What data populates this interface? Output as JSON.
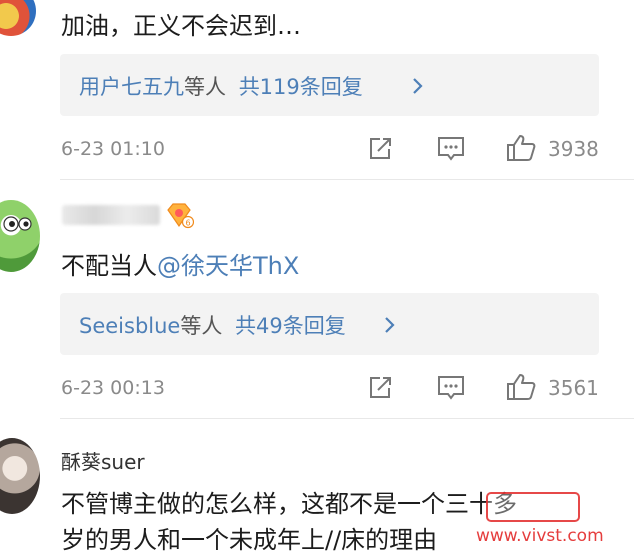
{
  "comments": [
    {
      "text": "加油，正义不会迟到…",
      "reply": {
        "names": "用户七五九",
        "mid": "等人",
        "count": "共119条回复"
      },
      "time": "6-23 01:10",
      "likes": "3938"
    },
    {
      "text_prefix": "不配当人",
      "mention": "@徐天华ThX",
      "reply": {
        "names": "Seeisblue",
        "mid": "等人",
        "count": "共49条回复"
      },
      "time": "6-23 00:13",
      "likes": "3561"
    },
    {
      "username": "酥葵suer",
      "text_line1": "不管博主做的怎么样，这都不是一个三十多",
      "text_line2": "岁的男人和一个未成年上//床的理由"
    }
  ],
  "watermark": {
    "text": "www.vivst.com"
  },
  "icons": {
    "share": "share-icon",
    "comment": "comment-icon",
    "like": "thumbs-up-icon",
    "chevron": "chevron-right-icon",
    "badge": "vip-badge-icon"
  },
  "colors": {
    "link": "#4d7fb7",
    "meta": "#8a8a8a",
    "reply_bg": "#f3f3f3",
    "watermark": "#e22828"
  }
}
